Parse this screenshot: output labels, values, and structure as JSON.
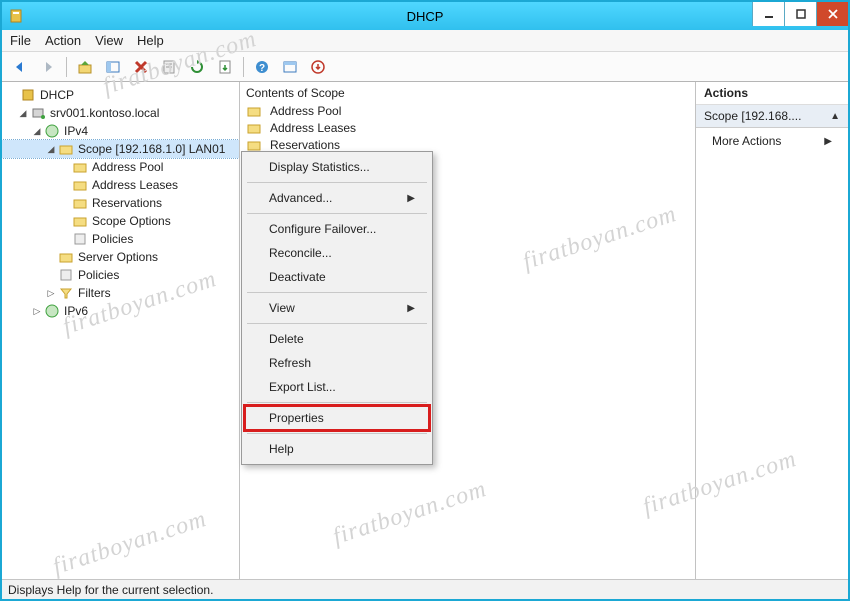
{
  "window": {
    "title": "DHCP"
  },
  "menubar": {
    "file": "File",
    "action": "Action",
    "view": "View",
    "help": "Help"
  },
  "tree": {
    "root": "DHCP",
    "server": "srv001.kontoso.local",
    "ipv4": "IPv4",
    "scope": "Scope [192.168.1.0] LAN01",
    "scope_children": {
      "address_pool": "Address Pool",
      "address_leases": "Address Leases",
      "reservations": "Reservations",
      "scope_options": "Scope Options",
      "policies": "Policies"
    },
    "server_options": "Server Options",
    "ipv4_policies": "Policies",
    "filters": "Filters",
    "ipv6": "IPv6"
  },
  "contents": {
    "header": "Contents of Scope",
    "items": {
      "address_pool": "Address Pool",
      "address_leases": "Address Leases",
      "reservations": "Reservations"
    }
  },
  "actions": {
    "header": "Actions",
    "scope_header": "Scope [192.168....",
    "more_actions": "More Actions"
  },
  "context_menu": {
    "display_statistics": "Display Statistics...",
    "advanced": "Advanced...",
    "configure_failover": "Configure Failover...",
    "reconcile": "Reconcile...",
    "deactivate": "Deactivate",
    "view": "View",
    "delete": "Delete",
    "refresh": "Refresh",
    "export_list": "Export List...",
    "properties": "Properties",
    "help": "Help"
  },
  "statusbar": {
    "text": "Displays Help for the current selection."
  },
  "watermark": "firatboyan.com"
}
